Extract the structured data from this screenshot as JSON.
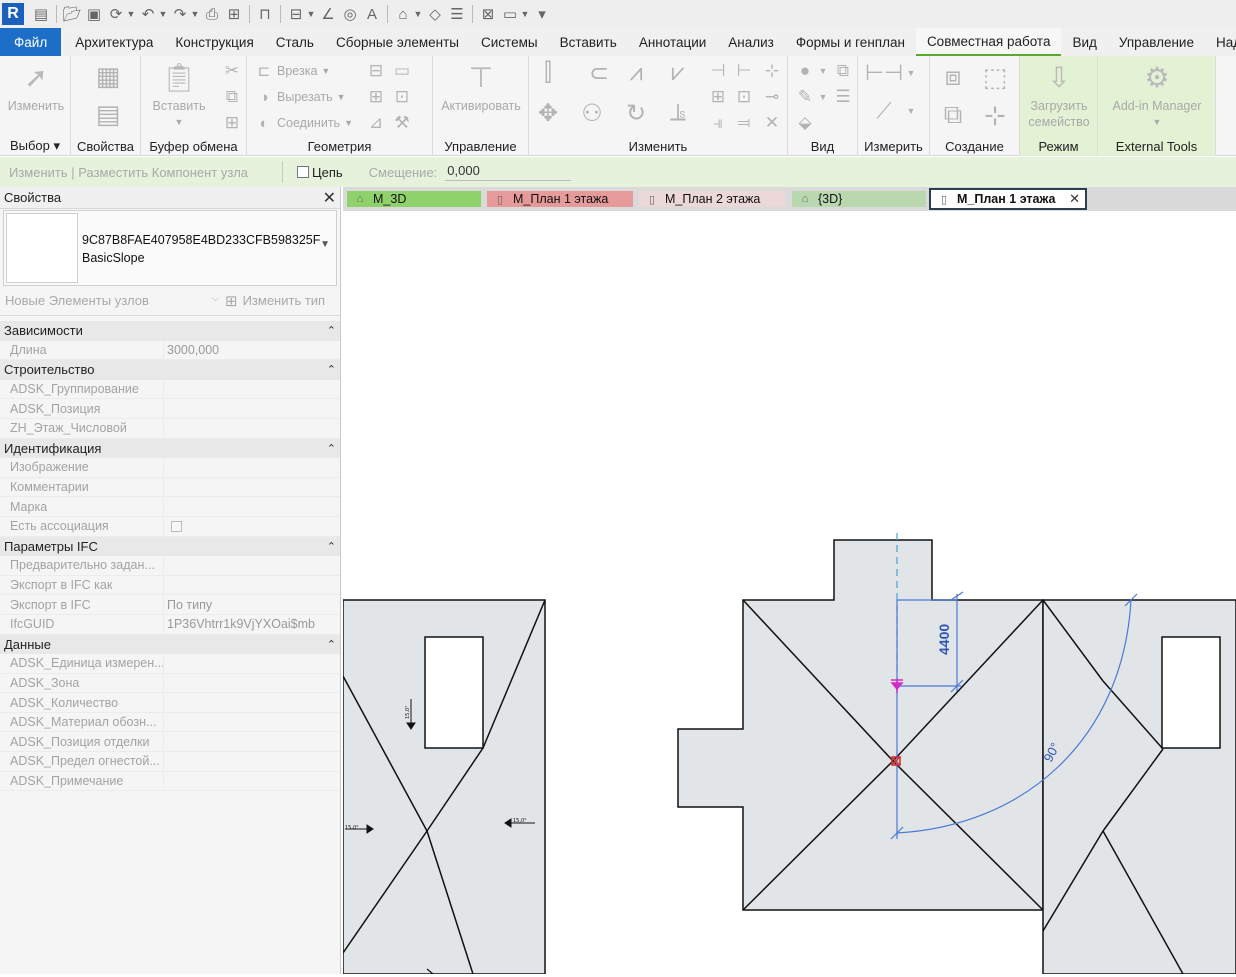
{
  "app": {
    "logo_letter": "R",
    "accent_color": "#1d6ec7"
  },
  "quick_access": {
    "icons": [
      "open-icon",
      "save-icon",
      "sync-icon",
      "undo-icon",
      "redo-icon",
      "print-icon",
      "measure-icon",
      "text-icon",
      "3d-view-icon",
      "switch-windows-icon"
    ]
  },
  "ribbon_tabs": [
    "Файл",
    "Архитектура",
    "Конструкция",
    "Сталь",
    "Сборные элементы",
    "Системы",
    "Вставить",
    "Аннотации",
    "Анализ",
    "Формы и генплан",
    "Совместная работа",
    "Вид",
    "Управление",
    "Надстройки"
  ],
  "ribbon": {
    "select": {
      "modify_label": "Изменить",
      "title": "Выбор"
    },
    "properties": {
      "title": "Свойства"
    },
    "clipboard": {
      "paste_label": "Вставить",
      "title": "Буфер обмена"
    },
    "geometry": {
      "cope_label": "Врезка",
      "cut_label": "Вырезать",
      "join_label": "Соединить",
      "title": "Геометрия"
    },
    "control": {
      "activate_label": "Активировать",
      "title": "Управление"
    },
    "modify": {
      "title": "Изменить"
    },
    "view": {
      "title": "Вид"
    },
    "measure": {
      "title": "Измерить"
    },
    "create": {
      "title": "Создание"
    },
    "mode": {
      "load_family_label_1": "Загрузить",
      "load_family_label_2": "семейство",
      "title": "Режим"
    },
    "external": {
      "addin_label": "Add-in Manager",
      "title": "External Tools"
    }
  },
  "options_bar": {
    "context": "Изменить | Разместить Компонент узла",
    "chain_label": "Цепь",
    "offset_label": "Смещение:",
    "offset_value": "0,000"
  },
  "properties_palette": {
    "title": "Свойства",
    "type_name_line1": "9C87B8FAE407958E4BD233CFB598325F",
    "type_name_line2": "BasicSlope",
    "filter_value": "Новые Элементы узлов",
    "edit_type_label": "Изменить тип",
    "groups": [
      {
        "name": "Зависимости",
        "rows": [
          {
            "k": "Длина",
            "v": "3000,000"
          }
        ]
      },
      {
        "name": "Строительство",
        "rows": [
          {
            "k": "ADSK_Группирование",
            "v": ""
          },
          {
            "k": "ADSK_Позиция",
            "v": ""
          },
          {
            "k": "ZH_Этаж_Числовой",
            "v": ""
          }
        ]
      },
      {
        "name": "Идентификация",
        "rows": [
          {
            "k": "Изображение",
            "v": ""
          },
          {
            "k": "Комментарии",
            "v": ""
          },
          {
            "k": "Марка",
            "v": ""
          },
          {
            "k": "Есть ассоциация",
            "v": "",
            "checkbox": true
          }
        ]
      },
      {
        "name": "Параметры IFC",
        "rows": [
          {
            "k": "Предварительно задан...",
            "v": ""
          },
          {
            "k": "Экспорт в IFC как",
            "v": ""
          },
          {
            "k": "Экспорт в IFC",
            "v": "По типу"
          },
          {
            "k": "IfcGUID",
            "v": "1P36Vhtrr1k9VjYXOai$mb"
          }
        ]
      },
      {
        "name": "Данные",
        "rows": [
          {
            "k": "ADSK_Единица измерен...",
            "v": ""
          },
          {
            "k": "ADSK_Зона",
            "v": ""
          },
          {
            "k": "ADSK_Количество",
            "v": ""
          },
          {
            "k": "ADSK_Материал обозн...",
            "v": ""
          },
          {
            "k": "ADSK_Позиция отделки",
            "v": ""
          },
          {
            "k": "ADSK_Предел огнестой...",
            "v": ""
          },
          {
            "k": "ADSK_Примечание",
            "v": ""
          }
        ]
      }
    ]
  },
  "view_tabs": [
    {
      "label": "M_3D",
      "color": "#8fd16a",
      "icon": "3d-view-icon"
    },
    {
      "label": "M_План 1 этажа",
      "color": "#e69a9a",
      "icon": "floor-plan-icon"
    },
    {
      "label": "M_План 2 этажа",
      "color": "#ecd8d8",
      "icon": "floor-plan-icon"
    },
    {
      "label": "{3D}",
      "color": "#b9d8b0",
      "icon": "3d-view-icon"
    },
    {
      "label": "M_План 1 этажа",
      "color": "#ffffff",
      "icon": "floor-plan-icon",
      "active": true
    }
  ],
  "drawing": {
    "dimension_value": "4400",
    "angle_value": "90°",
    "slope_label": "15,0°",
    "fill_color": "#e2e5e7",
    "annotation_color": "#3e6fd8"
  }
}
